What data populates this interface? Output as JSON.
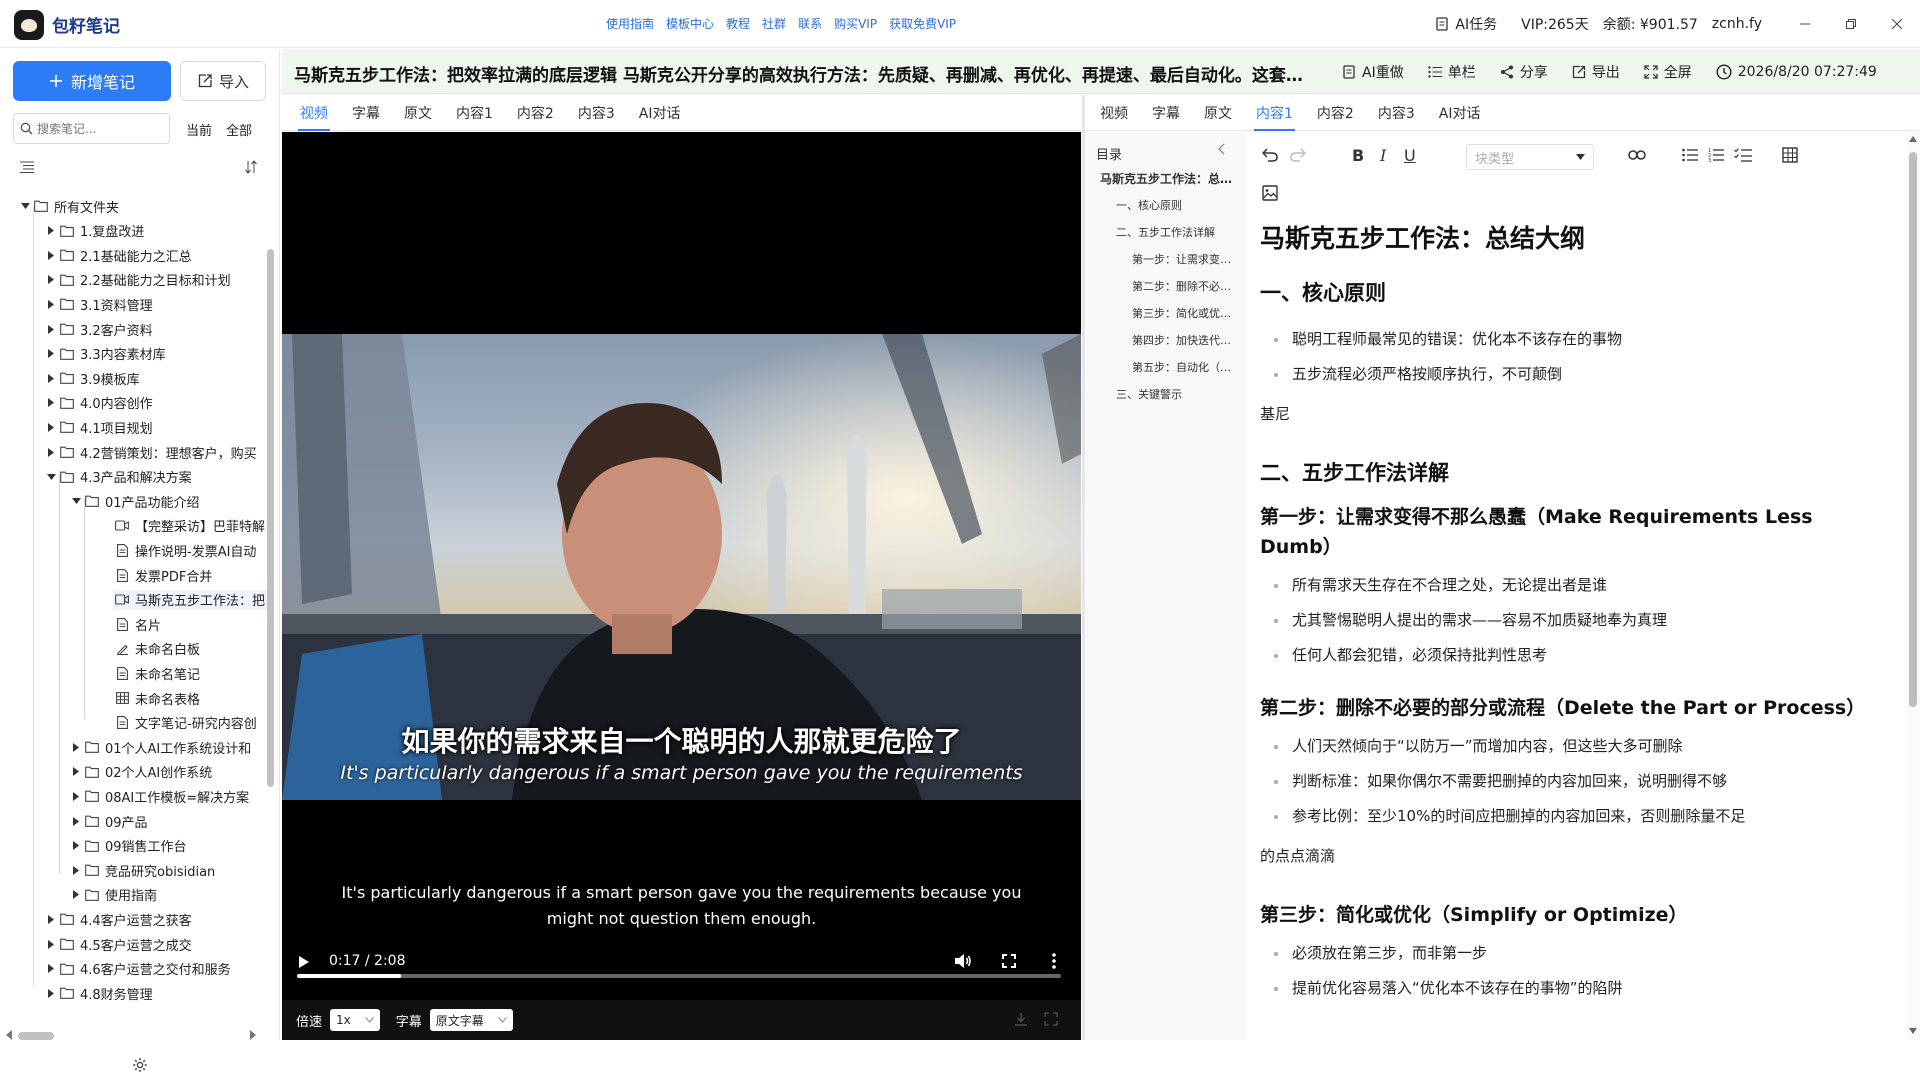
{
  "app": {
    "title": "包籽笔记"
  },
  "nav": [
    "使用指南",
    "模板中心",
    "教程",
    "社群",
    "联系",
    "购买VIP",
    "获取免费VIP"
  ],
  "topright": {
    "ai_task": "AI任务",
    "vip": "VIP:265天",
    "balance": "余额: ¥901.57",
    "user": "zcnh.fy"
  },
  "sidebar": {
    "new_note": "新增笔记",
    "import": "导入",
    "search_placeholder": "搜索笔记...",
    "scope_current": "当前",
    "scope_all": "全部",
    "tree": [
      {
        "label": "所有文件夹",
        "level": 0,
        "icon": "folder-icon",
        "expanded": true
      },
      {
        "label": "1.复盘改进",
        "level": 1,
        "icon": "folder-icon"
      },
      {
        "label": "2.1基础能力之汇总",
        "level": 1,
        "icon": "folder-icon"
      },
      {
        "label": "2.2基础能力之目标和计划",
        "level": 1,
        "icon": "folder-icon"
      },
      {
        "label": "3.1资料管理",
        "level": 1,
        "icon": "folder-icon"
      },
      {
        "label": "3.2客户资料",
        "level": 1,
        "icon": "folder-icon"
      },
      {
        "label": "3.3内容素材库",
        "level": 1,
        "icon": "folder-icon"
      },
      {
        "label": "3.9模板库",
        "level": 1,
        "icon": "folder-icon"
      },
      {
        "label": "4.0内容创作",
        "level": 1,
        "icon": "folder-icon"
      },
      {
        "label": "4.1项目规划",
        "level": 1,
        "icon": "folder-icon"
      },
      {
        "label": "4.2营销策划：理想客户，购买",
        "level": 1,
        "icon": "folder-icon"
      },
      {
        "label": "4.3产品和解决方案",
        "level": 1,
        "icon": "folder-icon",
        "expanded": true
      },
      {
        "label": "01产品功能介绍",
        "level": 2,
        "icon": "folder-icon",
        "expanded": true
      },
      {
        "label": "【完整采访】巴菲特解",
        "level": 3,
        "icon": "video-icon"
      },
      {
        "label": "操作说明-发票AI自动",
        "level": 3,
        "icon": "doc-icon"
      },
      {
        "label": "发票PDF合并",
        "level": 3,
        "icon": "doc-icon"
      },
      {
        "label": "马斯克五步工作法：把",
        "level": 3,
        "icon": "video-icon",
        "selected": true
      },
      {
        "label": "名片",
        "level": 3,
        "icon": "doc-icon"
      },
      {
        "label": "未命名白板",
        "level": 3,
        "icon": "whiteboard-icon"
      },
      {
        "label": "未命名笔记",
        "level": 3,
        "icon": "doc-icon"
      },
      {
        "label": "未命名表格",
        "level": 3,
        "icon": "table-icon"
      },
      {
        "label": "文字笔记-研究内容创",
        "level": 3,
        "icon": "doc-icon"
      },
      {
        "label": "01个人AI工作系统设计和",
        "level": 2,
        "icon": "folder-icon"
      },
      {
        "label": "02个人AI创作系统",
        "level": 2,
        "icon": "folder-icon"
      },
      {
        "label": "08AI工作模板=解决方案",
        "level": 2,
        "icon": "folder-icon"
      },
      {
        "label": "09产品",
        "level": 2,
        "icon": "folder-icon"
      },
      {
        "label": "09销售工作台",
        "level": 2,
        "icon": "folder-icon"
      },
      {
        "label": "竞品研究obisidian",
        "level": 2,
        "icon": "folder-icon"
      },
      {
        "label": "使用指南",
        "level": 2,
        "icon": "folder-icon"
      },
      {
        "label": "4.4客户运营之获客",
        "level": 1,
        "icon": "folder-icon"
      },
      {
        "label": "4.5客户运营之成交",
        "level": 1,
        "icon": "folder-icon"
      },
      {
        "label": "4.6客户运营之交付和服务",
        "level": 1,
        "icon": "folder-icon"
      },
      {
        "label": "4.8财务管理",
        "level": 1,
        "icon": "folder-icon"
      }
    ]
  },
  "doc": {
    "title": "马斯克五步工作法：把效率拉满的底层逻辑 马斯克公开分享的高效执行方法：先质疑、再删减、再优化、再提速、最后自动化。这套…",
    "actions": [
      "AI重做",
      "单栏",
      "分享",
      "导出",
      "全屏"
    ],
    "timestamp": "2026/8/20 07:27:49"
  },
  "left_tabs": [
    "视频",
    "字幕",
    "原文",
    "内容1",
    "内容2",
    "内容3",
    "AI对话"
  ],
  "right_tabs": [
    "视频",
    "字幕",
    "原文",
    "内容1",
    "内容2",
    "内容3",
    "AI对话"
  ],
  "video": {
    "sub_zh": "如果你的需求来自一个聪明的人那就更危险了",
    "sub_en": "It's particularly dangerous if a smart person gave you the requirements",
    "caption_line1": "It's particularly dangerous if a smart person gave you the requirements because you",
    "caption_line2": "might not question them enough.",
    "time": "0:17 / 2:08",
    "progress": 0.136,
    "speed_label": "倍速",
    "speed_value": "1x",
    "subtitle_label": "字幕",
    "subtitle_value": "原文字幕"
  },
  "toc": {
    "title": "目录",
    "items": [
      {
        "label": "马斯克五步工作法：总…",
        "level": 0
      },
      {
        "label": "一、核心原则",
        "level": 1
      },
      {
        "label": "二、五步工作法详解",
        "level": 1
      },
      {
        "label": "第一步：让需求变…",
        "level": 2
      },
      {
        "label": "第二步：删除不必…",
        "level": 2
      },
      {
        "label": "第三步：简化或优…",
        "level": 2
      },
      {
        "label": "第四步：加快迭代…",
        "level": 2
      },
      {
        "label": "第五步：自动化（…",
        "level": 2
      },
      {
        "label": "三、关键警示",
        "level": 1
      }
    ]
  },
  "editor": {
    "block_type_placeholder": "块类型",
    "h1": "马斯克五步工作法：总结大纲",
    "s1_title": "一、核心原则",
    "s1_items": [
      "聪明工程师最常见的错误：优化本不该存在的事物",
      "五步流程必须严格按顺序执行，不可颠倒"
    ],
    "p1": "基尼",
    "s2_title": "二、五步工作法详解",
    "step1_title": "第一步：让需求变得不那么愚蠢（Make Requirements Less Dumb）",
    "step1_items": [
      "所有需求天生存在不合理之处，无论提出者是谁",
      "尤其警惕聪明人提出的需求——容易不加质疑地奉为真理",
      "任何人都会犯错，必须保持批判性思考"
    ],
    "step2_title": "第二步：删除不必要的部分或流程（Delete the Part or Process）",
    "step2_items": [
      "人们天然倾向于“以防万一”而增加内容，但这些大多可删除",
      "判断标准：如果你偶尔不需要把删掉的内容加回来，说明删得不够",
      "参考比例：至少10%的时间应把删掉的内容加回来，否则删除量不足"
    ],
    "p2": "的点点滴滴",
    "step3_title": "第三步：简化或优化（Simplify or Optimize）",
    "step3_items": [
      "必须放在第三步，而非第一步",
      "提前优化容易落入“优化本不该存在的事物”的陷阱"
    ]
  }
}
